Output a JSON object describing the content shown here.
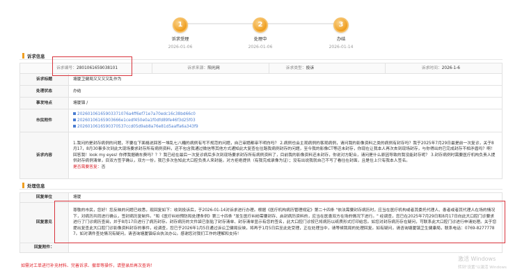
{
  "steps": [
    {
      "num": "1",
      "label": "诉求受理",
      "date": "2026-01-06"
    },
    {
      "num": "2",
      "label": "处理中",
      "date": "2026-01-06"
    },
    {
      "num": "3",
      "label": "办结",
      "date": "2026-01-14"
    }
  ],
  "appeal": {
    "section_title": "诉求信息",
    "id_label": "诉求编号：",
    "id": "2801061659038101",
    "source_label": "诉求来源：",
    "source": "阳光网",
    "type_label": "诉求类型：",
    "type": "投诉",
    "time_label": "诉求时间：",
    "time": "2026-1-6",
    "title_label": "诉求标题",
    "title": "塘厦卫健局又又又又乱作为",
    "status_label": "处理状态",
    "status": "办结",
    "place_label": "事发地点",
    "place": "塘厦镇 /",
    "att_label": "市民附件",
    "attachments": [
      "20260106165903371076a4ff6ef71e7a70edc16c38bd66c0",
      "20260106165903666e1cedf450e0a1f0dfd89fe46f3d25f03",
      "2026010616590370537ccd05d9ab8a76e81d5aaffa6a343f9"
    ],
    "content_label": "诉求内容",
    "content": "1.我问的是封存病例的问题，不要在下面格说回答一堆乱七八糟的病例有写不规范的问题，自己审题都审不明白吗？ 2.病例也会主观病例的客观病例，请问我的影像资料之类的病例有封存吗？我于2025年7月29日最是前一次复诊，关于8月17，8月30事多次到此大现场要求封存所有病例资料，还不包含我通过微信等其他方式通知此大复查在往路我病例封存的问题，至今我的影像CT等还未封存，你现在让我本人再次去到现场封存，与你得出的已完成封存不相矛盾吗？啊！回答我！look my eyes! 你得我据确车费吗？？？我已经在最后一次复诊病后多次到现场要求封存所有病例资料了，目前我的影像资料还未封存，你说对方配合，请问是什么原因导致的我没能封存呢？ 3.封存病例时需要医疗机构负责人提供封存病例清单，目双方签字确认，双方一份，我已多次告知此大口腔负责人来封能，对方拒绝提供（有我完成录像为证）；没有出说我就自己不写了看往在封面，且是住上只有我本人签名。",
    "reply_flag_label": "是否需要答复：",
    "reply_flag": "否"
  },
  "handling": {
    "section_title": "处理信息",
    "unit_label": "回复单位",
    "unit": "塘厦",
    "opinion_label": "回复意见",
    "opinion": "尊敬的市民，您好！您反映的问题已收悉，现回复如下：收到投诉后，于2026-01-14对诉求进行办理。根据《医疗机构病历管理规定》第二十四条 \"依法需要封存病历时，应当在医疗机构或者其委托代理人、患者或者其代理人在场的情况下，对病历共同进行确认，签封病历复制件。\"和《医疗纠纷预防和处理条例》第二十四条 \"发生医疗纠纷需要封存、启封病历资料的，应当在医患双方在场的情况下进行。\" 经调查，您已在2025年7月29日和8月17日向此大口腔门诊要求进行了门诊病历查阅，并于8月17日进行了病历封存。封存病历的文件袋已张贴了封存清单、封存清单显示有您的签名，此大口腔门诊按已将病历以纸质形式打印给您。如您对封存病历存在疑问，可联系此大口腔门诊进行申请处理。关于您提出复查此大口腔门诊影像资料封存的事件，经调查，您已于2026年1月5日通过诉讼卫健局反映，将再于1月5日后至此处受理，正在处理当中，请等候我局的处理回复。如有疑问，请咨询塘厦镇卫生健康局，联系电话：0769-82777787。如对满件查处情况有疑问，请咨询塘厦镇综合执法办公。感谢您对我们工作的理解和支持！",
    "attach_label": "回复附件："
  },
  "footer": {
    "note": "如需对工单进行补充材料、完善诉求、撤单等操作，请登录后再次查询！"
  },
  "watermark": {
    "line1": "激活 Windows",
    "line2": "转到\"设置\"以激活 Windows"
  },
  "colors": {
    "accent": "#ef9e20",
    "link": "#4a7dd1",
    "highlight_box": "#d8323a",
    "warning_text": "#e0242c"
  }
}
